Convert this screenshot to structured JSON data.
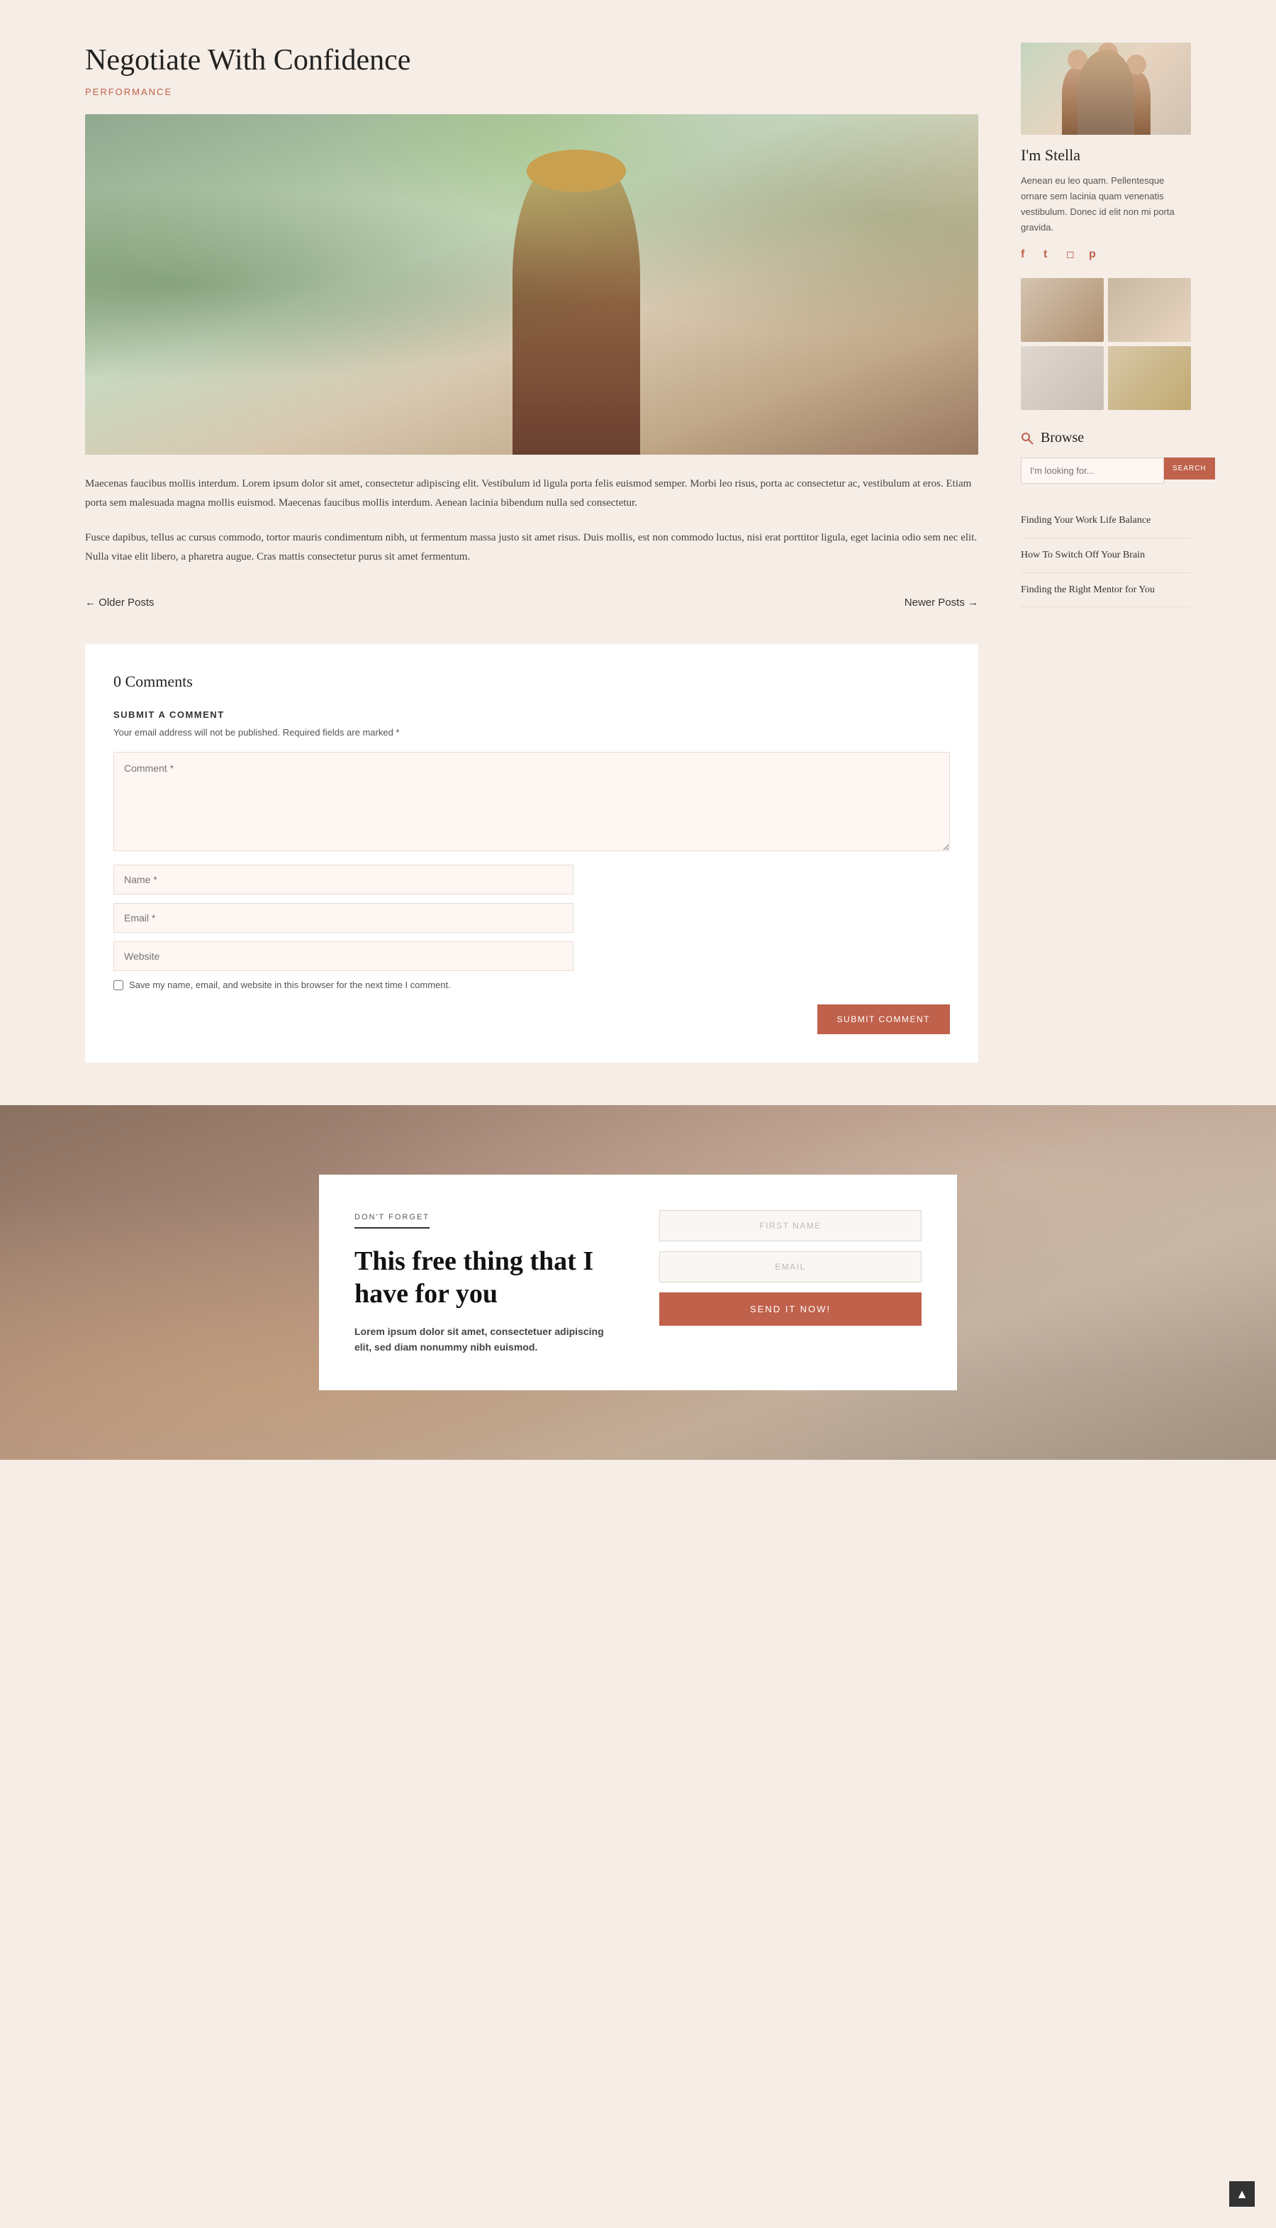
{
  "page": {
    "background_color": "#f5ede6"
  },
  "article": {
    "title": "Negotiate With Confidence",
    "category": "PERFORMANCE",
    "body_paragraph_1": "Maecenas faucibus mollis interdum. Lorem ipsum dolor sit amet, consectetur adipiscing elit. Vestibulum id ligula porta felis euismod semper. Morbi leo risus, porta ac consectetur ac, vestibulum at eros. Etiam porta sem malesuada magna mollis euismod. Maecenas faucibus mollis interdum. Aenean lacinia bibendum nulla sed consectetur.",
    "body_paragraph_2": "Fusce dapibus, tellus ac cursus commodo, tortor mauris condimentum nibh, ut fermentum massa justo sit amet risus. Duis mollis, est non commodo luctus, nisi erat porttitor ligula, eget lacinia odio sem nec elit. Nulla vitae elit libero, a pharetra augue. Cras mattis consectetur purus sit amet fermentum."
  },
  "pagination": {
    "older_posts": "← Older Posts",
    "newer_posts": "Newer Posts →"
  },
  "comments": {
    "count_label": "0 Comments",
    "submit_heading": "SUBMIT A COMMENT",
    "note_text": "Your email address will not be published.",
    "note_required": "Required fields are marked *",
    "comment_placeholder": "Comment *",
    "name_placeholder": "Name *",
    "email_placeholder": "Email *",
    "website_placeholder": "Website",
    "save_checkbox_label": "Save my name, email, and website in this browser for the next time I comment.",
    "submit_button_label": "SUBMIT COMMENT"
  },
  "sidebar": {
    "author_name": "I'm Stella",
    "author_bio": "Aenean eu leo quam. Pellentesque ornare sem lacinia quam venenatis vestibulum. Donec id elit non mi porta gravida.",
    "social_icons": [
      {
        "name": "facebook-icon",
        "symbol": "f"
      },
      {
        "name": "twitter-icon",
        "symbol": "t"
      },
      {
        "name": "instagram-icon",
        "symbol": "◻"
      },
      {
        "name": "pinterest-icon",
        "symbol": "p"
      }
    ],
    "browse_title": "Browse",
    "search_placeholder": "I'm looking for...",
    "search_button_label": "SEARCH",
    "recent_posts": [
      {
        "title": "Finding Your Work Life Balance"
      },
      {
        "title": "How To Switch Off Your Brain"
      },
      {
        "title": "Finding the Right Mentor for You"
      }
    ]
  },
  "cta": {
    "dont_forget_label": "DON'T FORGET",
    "headline": "This free thing that I have for you",
    "body_text": "Lorem ipsum dolor sit amet, consectetuer adipiscing elit, sed diam nonummy nibh euismod.",
    "first_name_placeholder": "FIRST NAME",
    "email_placeholder": "EMAIL",
    "send_button_label": "SEND IT NOW!"
  },
  "scroll_top": {
    "icon": "▲"
  }
}
